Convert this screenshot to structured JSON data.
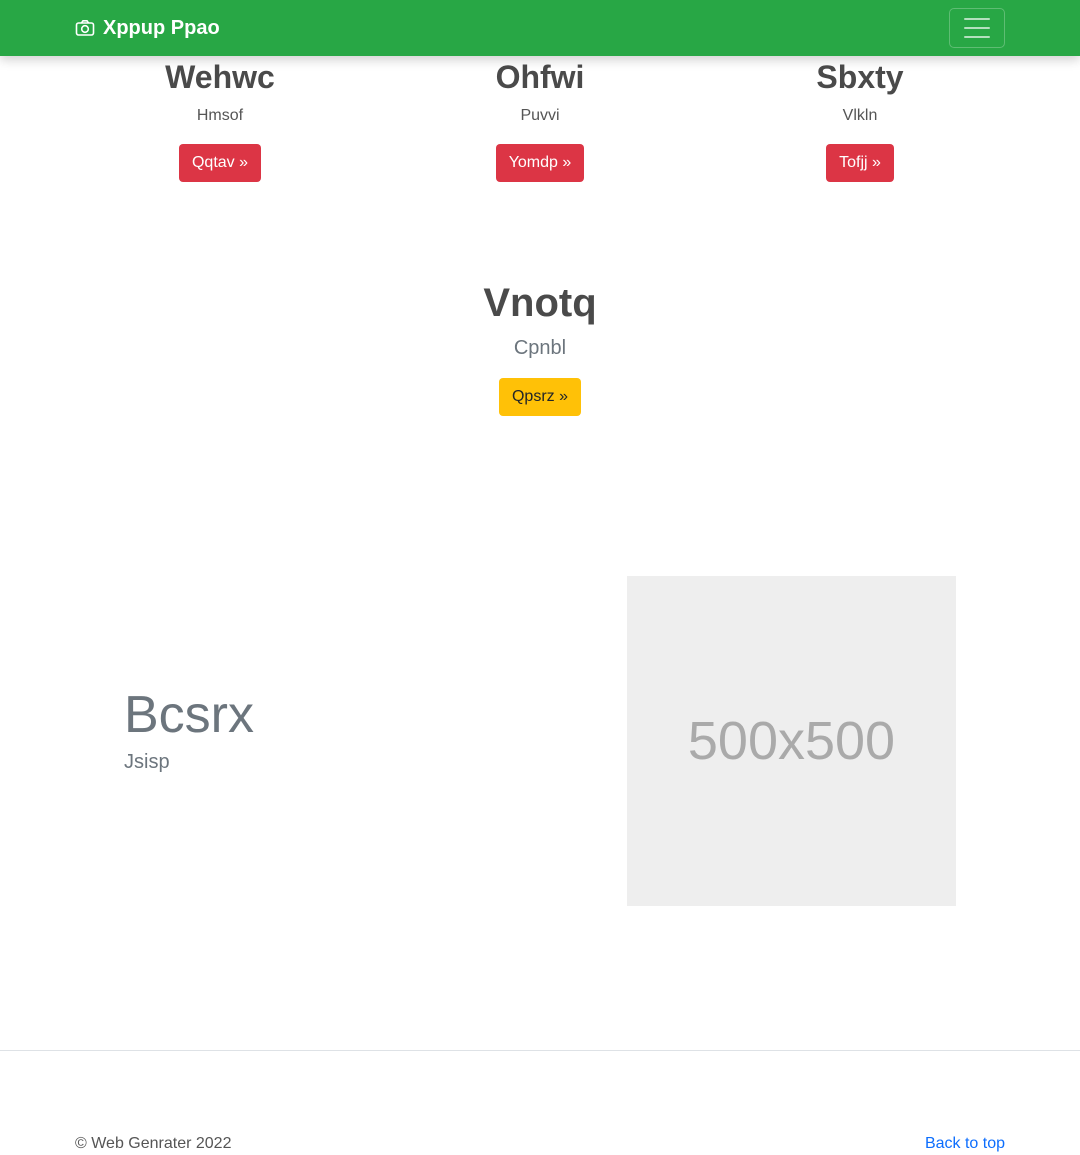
{
  "navbar": {
    "brand": "Xppup Ppao",
    "brand_icon": "camera-icon",
    "menu_icon": "hamburger-menu-icon",
    "bg_color": "#28a745"
  },
  "columns": [
    {
      "title": "Wehwc",
      "text": "Hmsof",
      "button": "Qqtav »"
    },
    {
      "title": "Ohfwi",
      "text": "Puvvi",
      "button": "Yomdp »"
    },
    {
      "title": "Sbxty",
      "text": "Vlkln",
      "button": "Tofjj »"
    }
  ],
  "hero": {
    "title": "Vnotq",
    "subtitle": "Cpnbl",
    "button": "Qpsrz »"
  },
  "feature": {
    "title": "Bcsrx",
    "subtitle": "Jsisp",
    "image_label": "500x500"
  },
  "footer": {
    "copyright": "© Web Genrater 2022",
    "back_to_top": "Back to top"
  },
  "colors": {
    "danger": "#dc3545",
    "warning": "#ffc107",
    "link": "#0d6efd"
  }
}
